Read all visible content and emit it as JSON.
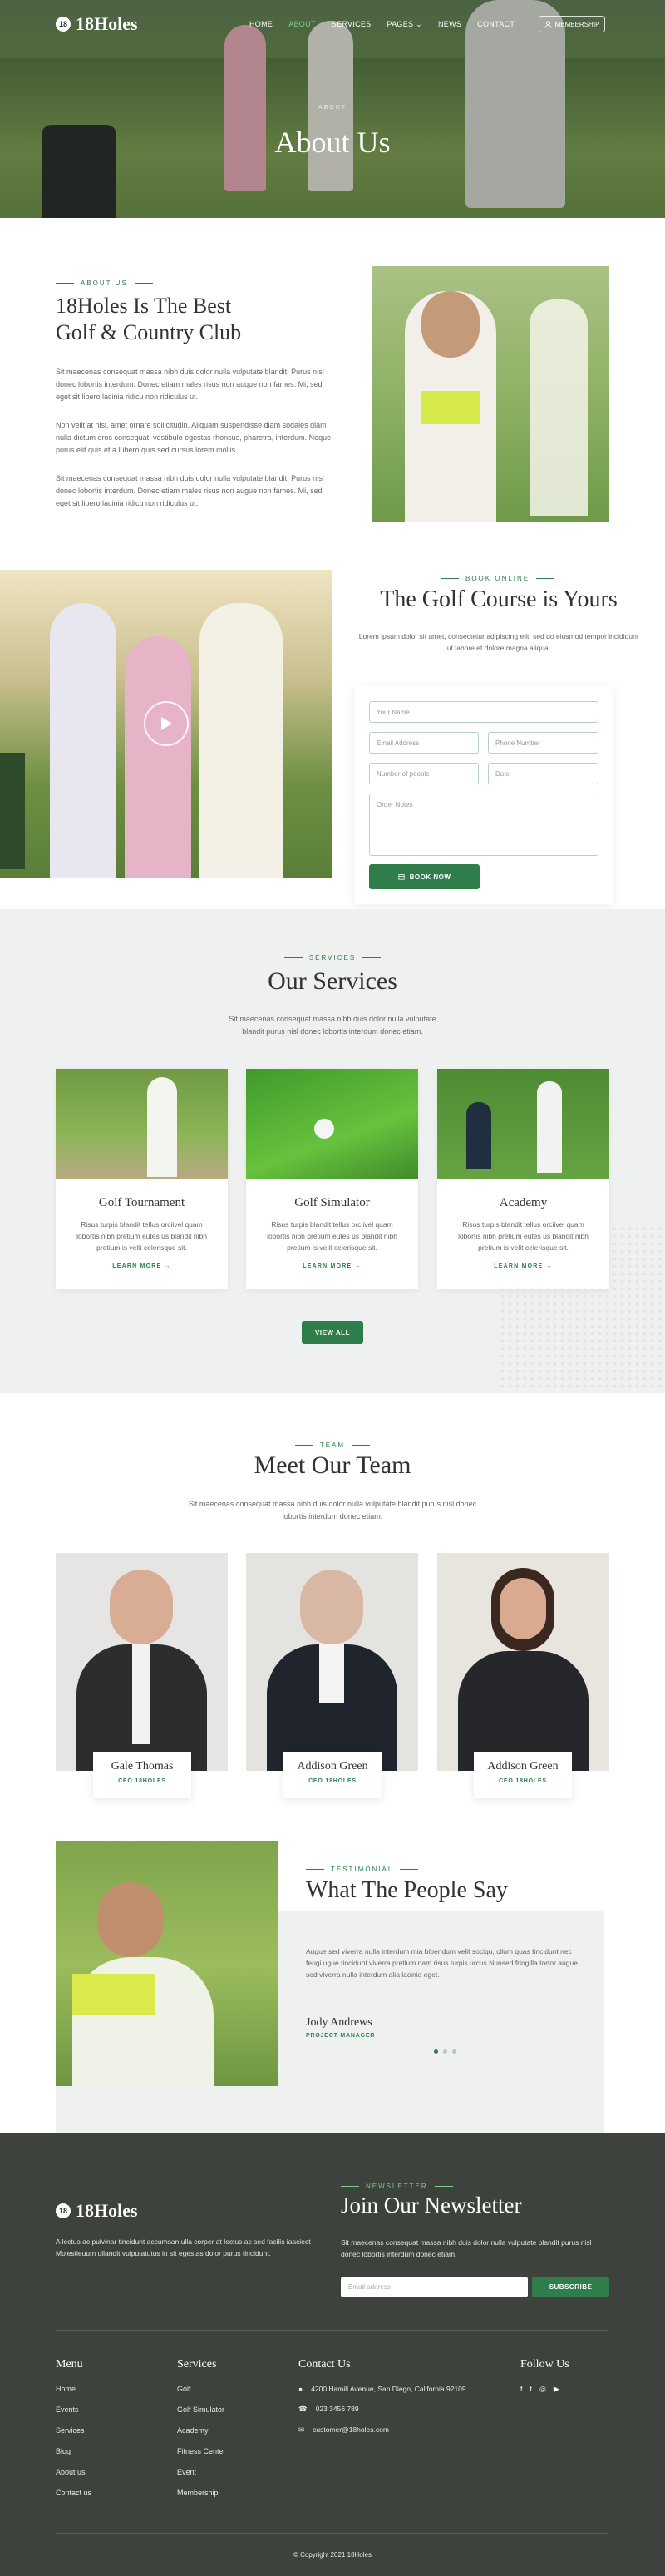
{
  "header": {
    "logo_text": "18Holes",
    "logo_badge": "18",
    "nav": [
      "HOME",
      "ABOUT",
      "SERVICES",
      "PAGES",
      "NEWS",
      "CONTACT"
    ],
    "pages_caret": "⌄",
    "membership_label": "MEMBERSHIP",
    "user_icon": "user-icon"
  },
  "hero": {
    "kicker": "ABOUT",
    "title": "About Us"
  },
  "about": {
    "kicker": "ABOUT US",
    "title_line1": "18Holes Is The Best",
    "title_line2": "Golf & Country Club",
    "p1": "Sit maecenas consequat massa nibh duis dolor nulla vulputate blandit. Purus nisl donec lobortis interdum. Donec etiam males risus non augue non fames. Mi, sed eget sit libero lacinia ridicu non ridiculus ut.",
    "p2": "Non velit at nisi, amet ornare sollicitudin. Aliquam suspendisse diam sodales diam nulla dictum eros consequat, vestibulo egestas rhoncus, pharetra, interdum. Neque purus elit quis et a Libero quis sed cursus lorem mollis.",
    "p3": "Sit maecenas consequat massa nibh duis dolor nulla vulputate blandit. Purus nisl donec lobortis interdum. Donec etiam males risus non augue non fames. Mi, sed eget sit libero lacinia ridicu non ridiculus ut."
  },
  "booking": {
    "kicker": "BOOK ONLINE",
    "title": "The Golf Course is Yours",
    "sub": "Lorem ipsum dolor sit amet, consectetur adipiscing elit, sed do eiusmod tempor incididunt ut labore et dolore magna aliqua.",
    "placeholders": {
      "name": "Your Name",
      "email": "Email Address",
      "phone": "Phone Number",
      "people": "Number of people",
      "date": "Date",
      "notes": "Order Notes"
    },
    "button": "BOOK NOW"
  },
  "services": {
    "kicker": "SERVICES",
    "title": "Our Services",
    "sub_line1": "Sit maecenas consequat massa nibh duis dolor nulla vulputate",
    "sub_line2": "blandit purus nisl donec lobortis interdum donec etiam.",
    "items": [
      {
        "title": "Golf Tournament",
        "text": "Risus turpis blandit tellus orciivel quam lobortis nibh pretium eutes us blandit nibh pretium is velit celerisque sit.",
        "link": "LEARN MORE"
      },
      {
        "title": "Golf Simulator",
        "text": "Risus turpis blandit tellus orciivel quam lobortis nibh pretium eutes us blandit nibh pretium is velit celerisque sit.",
        "link": "LEARN MORE"
      },
      {
        "title": "Academy",
        "text": "Risus turpis blandit tellus orciivel quam lobortis nibh pretium eutes us blandit nibh pretium is velit celerisque sit.",
        "link": "LEARN MORE"
      }
    ],
    "view_all": "VIEW ALL"
  },
  "team": {
    "kicker": "TEAM",
    "title": "Meet Our Team",
    "sub_line1": "Sit maecenas consequat massa nibh duis dolor nulla vulputate blandit purus nisl donec",
    "sub_line2": "lobortis interdum donec etiam.",
    "members": [
      {
        "name": "Gale Thomas",
        "role": "CEO 18HOLES"
      },
      {
        "name": "Addison Green",
        "role": "CEO 18HOLES"
      },
      {
        "name": "Addison Green",
        "role": "CEO 18HOLES"
      }
    ]
  },
  "testimonial": {
    "kicker": "TESTIMONIAL",
    "title": "What The People Say",
    "quote": "Augue sed viverra nulla interdum mia bibendum velit sociqu, cilum quas tincidunt nec feugi ugue tincidunt viverra pretium nam risus turpis urcus Nunsed fringilla tortor augue sed viverra nulla interdum alia lacinia eget.",
    "name": "Jody Andrews",
    "role": "PROJECT MANAGER"
  },
  "newsletter": {
    "kicker": "NEWSLETTER",
    "title": "Join Our Newsletter",
    "sub": "Sit maecenas consequat massa nibh duis dolor nulla vulputate blandit purus nisl donec lobortis interdum donec etiam.",
    "email_placeholder": "Email address",
    "button": "SUBSCRIBE"
  },
  "footer": {
    "logo_text": "18Holes",
    "about": "A lectus ac pulvinar tincidunt accumsan ulla corper at lectus ac sed facilis iaaciect Molestieuum ullandit vulputatutus in sit egestas dolor purus tincidunt.",
    "menu_title": "Menu",
    "menu": [
      "Home",
      "Events",
      "Services",
      "Blog",
      "About us",
      "Contact us"
    ],
    "services_title": "Services",
    "services": [
      "Golf",
      "Golf Simulator",
      "Academy",
      "Fitness Center",
      "Event",
      "Membership"
    ],
    "contact_title": "Contact Us",
    "address": "4200 Hamill Avenue, San Diego, California 92109",
    "phone": "023 3456 789",
    "email": "customer@18holes.com",
    "follow_title": "Follow Us",
    "social": [
      "f",
      "t",
      "◎",
      "▶"
    ],
    "copyright": "© Copyright 2021 18Holes"
  },
  "colors": {
    "accent": "#2e7d4a",
    "footer_bg": "#3d423d",
    "section_bg": "#eef1ef"
  }
}
